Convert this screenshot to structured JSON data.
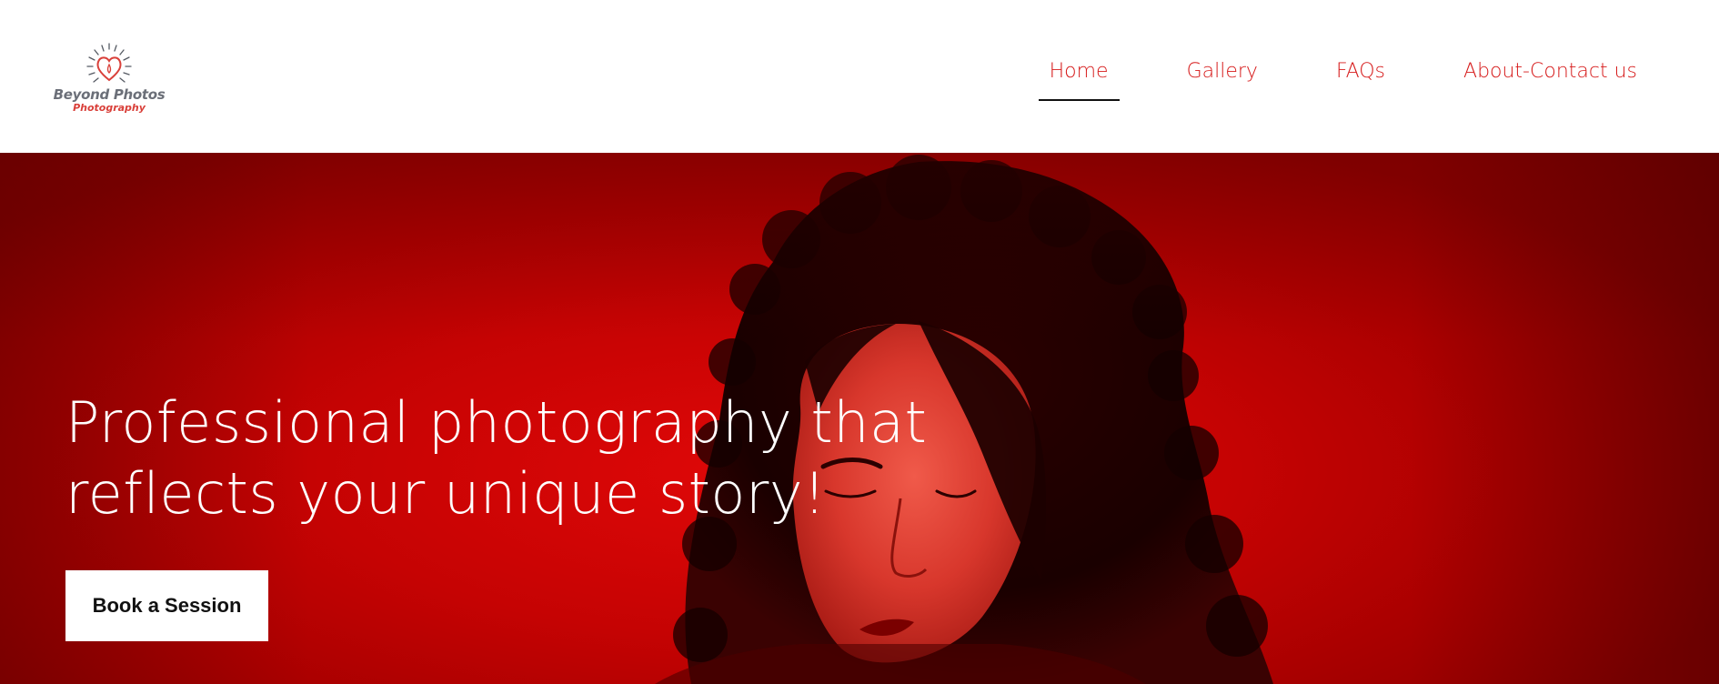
{
  "brand": {
    "name_line1": "Beyond Photos",
    "name_line2": "Photography",
    "icon": "heart-sun-icon"
  },
  "nav": {
    "items": [
      {
        "label": "Home",
        "active": true
      },
      {
        "label": "Gallery",
        "active": false
      },
      {
        "label": "FAQs",
        "active": false
      },
      {
        "label": "About-Contact us",
        "active": false
      }
    ]
  },
  "hero": {
    "title_line1": "Professional photography that",
    "title_line2": "reflects your unique story!",
    "cta_label": "Book a Session",
    "image": "portrait-of-woman-in-red-light"
  },
  "colors": {
    "accent": "#d61a1a",
    "hero_red": "#c50303",
    "logo_gray": "#6b6f78",
    "logo_red": "#d9403a",
    "text_light": "#ffffff"
  }
}
